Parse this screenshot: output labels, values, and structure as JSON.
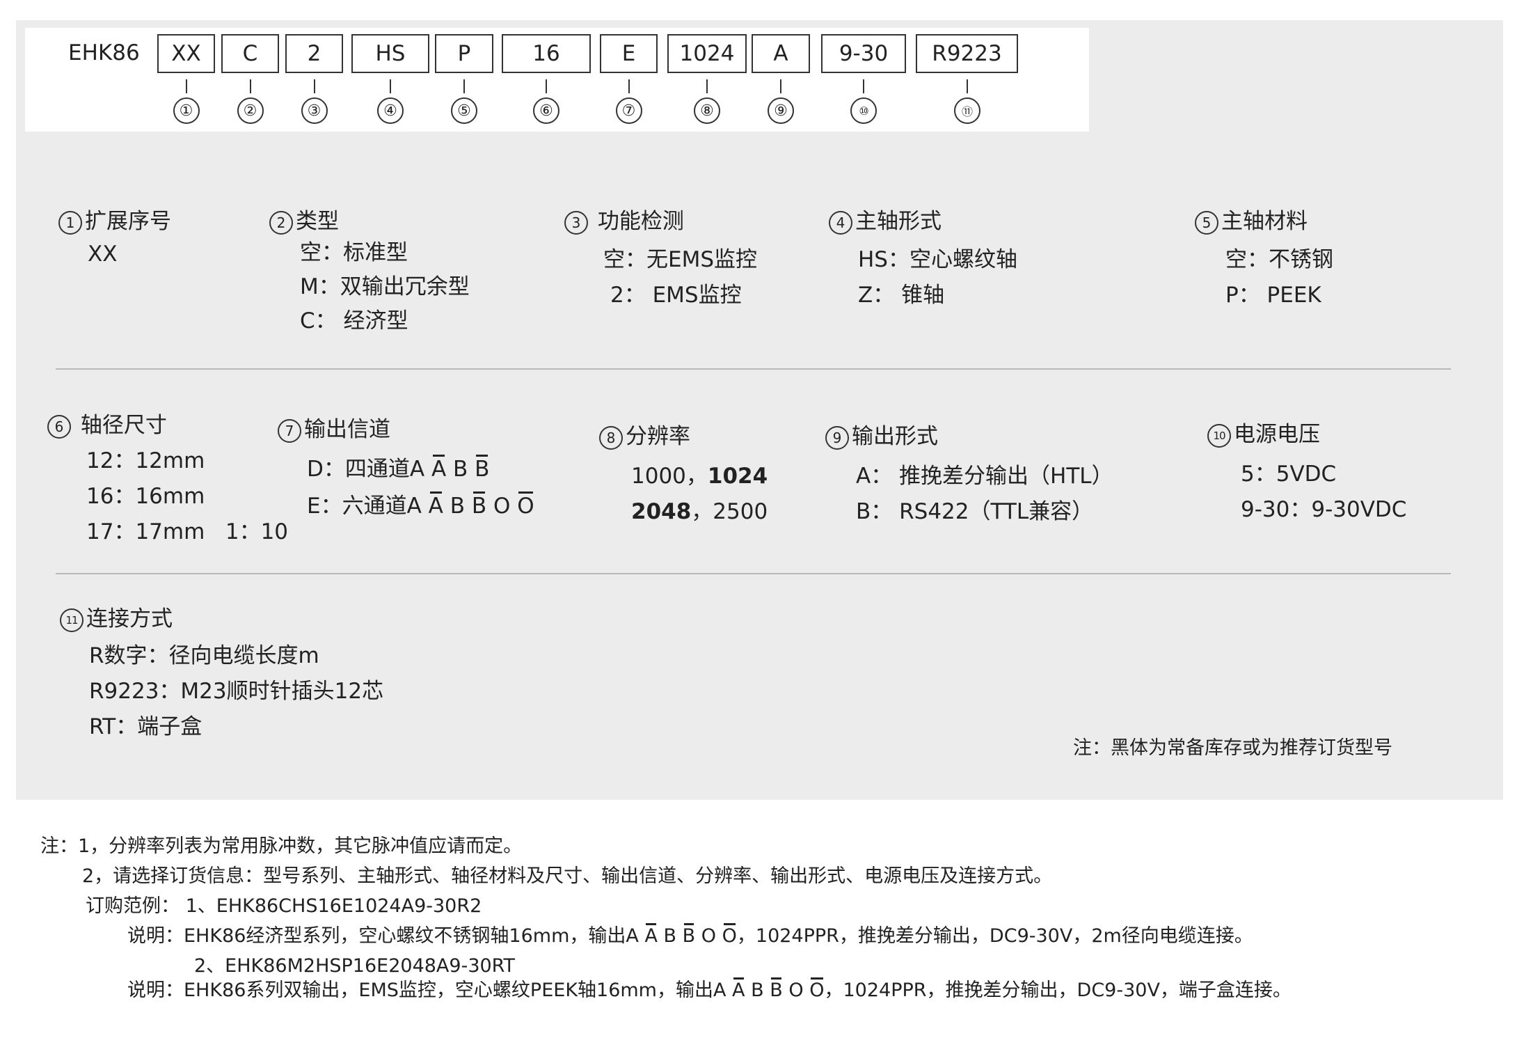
{
  "code": {
    "prefix": "EHK86",
    "boxes": [
      "XX",
      "C",
      "2",
      "HS",
      "P",
      "16",
      "E",
      "1024",
      "A",
      "9-30",
      "R9223"
    ],
    "numbers": [
      "①",
      "②",
      "③",
      "④",
      "⑤",
      "⑥",
      "⑦",
      "⑧",
      "⑨",
      "⑩",
      "⑪"
    ]
  },
  "sections": {
    "s1": {
      "badge": "1",
      "title": "扩展序号",
      "lines": [
        "XX"
      ]
    },
    "s2": {
      "badge": "2",
      "title": "类型",
      "lines": [
        "空：标准型",
        "M：双输出冗余型",
        "C： 经济型"
      ]
    },
    "s3": {
      "badge": "3",
      "title": "功能检测",
      "lines": [
        "空：无EMS监控",
        "2： EMS监控"
      ]
    },
    "s4": {
      "badge": "4",
      "title": "主轴形式",
      "lines": [
        "HS：空心螺纹轴",
        "Z： 锥轴"
      ]
    },
    "s5": {
      "badge": "5",
      "title": "主轴材料",
      "lines": [
        "空：不锈钢",
        "P： PEEK"
      ]
    },
    "s6": {
      "badge": "6",
      "title": "轴径尺寸",
      "lines": [
        "12：12mm",
        "16：16mm",
        "17：17mm   1：10"
      ]
    },
    "s7": {
      "badge": "7",
      "title": "输出信道",
      "d_prefix": "D：四通道A ",
      "e_prefix": "E：六通道A ",
      "a": "A",
      "b": "B",
      "o": "O",
      "ab": "B"
    },
    "s8": {
      "badge": "8",
      "title": "分辨率",
      "l1a": "1000，",
      "l1b": "1024",
      "l2a": "2048",
      "l2b": "，2500"
    },
    "s9": {
      "badge": "9",
      "title": "输出形式",
      "lines": [
        "A： 推挽差分输出（HTL）",
        "B： RS422（TTL兼容）"
      ]
    },
    "s10": {
      "badge": "10",
      "title": "电源电压",
      "lines": [
        "5：5VDC",
        "9-30：9-30VDC"
      ]
    },
    "s11": {
      "badge": "11",
      "title": "连接方式",
      "lines": [
        "R数字：径向电缆长度m",
        "R9223：M23顺时针插头12芯",
        "RT：端子盒"
      ]
    }
  },
  "panel_note": "注：黑体为常备库存或为推荐订货型号",
  "notes": {
    "n1": "注：1，分辨率列表为常用脉冲数，其它脉冲值应请而定。",
    "n2": "2，请选择订货信息：型号系列、主轴形式、轴径材料及尺寸、输出信道、分辨率、输出形式、电源电压及连接方式。",
    "n3": "订购范例： 1、EHK86CHS16E1024A9-30R2",
    "n4a": "说明：EHK86经济型系列，空心螺纹不锈钢轴16mm，输出A ",
    "n4b": "，1024PPR，推挽差分输出，DC9-30V，2m径向电缆连接。",
    "n5": "2、EHK86M2HSP16E2048A9-30RT",
    "n6a": "说明：EHK86系列双输出，EMS监控，空心螺纹PEEK轴16mm，输出A ",
    "n6b": "，1024PPR，推挽差分输出，DC9-30V，端子盒连接。"
  }
}
